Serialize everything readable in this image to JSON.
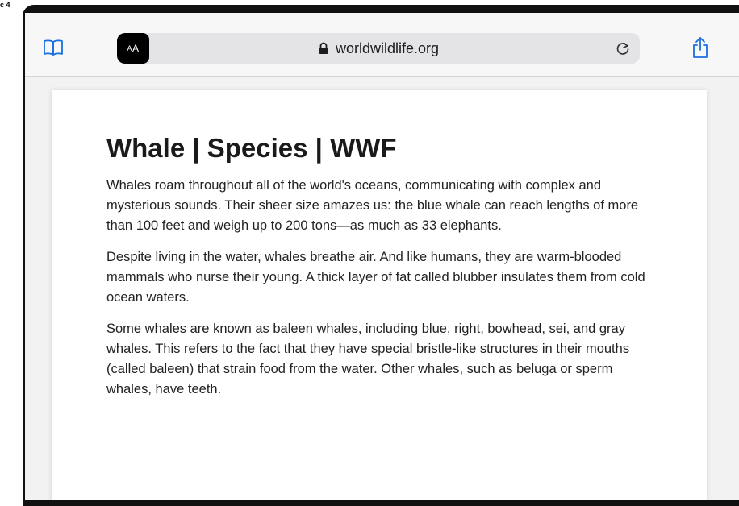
{
  "status": {
    "corner_text": "c 4"
  },
  "toolbar": {
    "reader_icon": "book-icon",
    "aa_label_small": "A",
    "aa_label_large": "A",
    "url": "worldwildlife.org",
    "lock_icon": "lock-icon",
    "reload_icon": "reload-icon",
    "share_icon": "share-icon",
    "accent_color": "#1a6fe0"
  },
  "article": {
    "title": "Whale | Species | WWF",
    "paragraphs": [
      "Whales roam throughout all of the world's oceans, communicating with complex and mysterious sounds. Their sheer size amazes us: the blue whale can reach lengths of more than 100 feet and weigh up to 200 tons—as much as 33 elephants.",
      "Despite living in the water, whales breathe air. And like humans, they are warm-blooded mammals who nurse their young. A thick layer of fat called blubber insulates them from cold ocean waters.",
      "Some whales are known as baleen whales, including blue, right, bowhead, sei, and gray whales. This refers to the fact that they have special bristle-like structures in their mouths (called baleen) that strain food from the water. Other whales, such as beluga or sperm whales, have teeth."
    ]
  }
}
